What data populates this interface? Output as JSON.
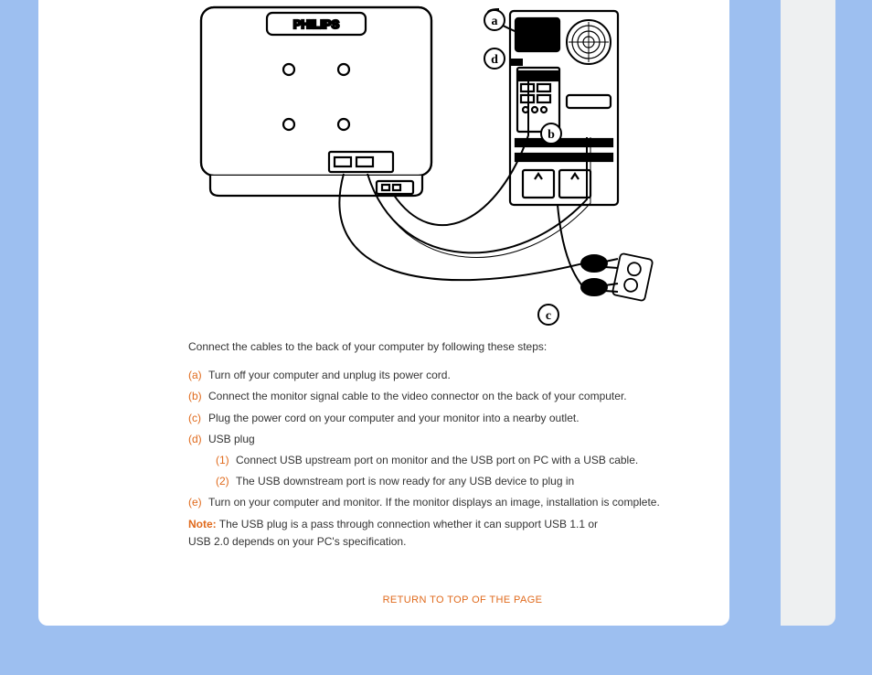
{
  "diagram": {
    "brand": "PHILIPS",
    "callouts": [
      "a",
      "d",
      "b",
      "c"
    ]
  },
  "intro": "Connect the cables to the back of your computer by following these steps:",
  "steps": [
    {
      "label": "(a)",
      "text": "Turn off your computer and unplug its power cord."
    },
    {
      "label": "(b)",
      "text": "Connect the monitor signal cable to the video connector on the back of your computer."
    },
    {
      "label": "(c)",
      "text": "Plug the power cord on your computer and your monitor into a nearby outlet."
    },
    {
      "label": "(d)",
      "text": "USB plug",
      "subs": [
        {
          "label": "(1)",
          "text": "Connect USB upstream port on monitor and the USB port on PC with a USB cable."
        },
        {
          "label": "(2)",
          "text": "The USB downstream port is now ready for any USB device to plug in"
        }
      ]
    },
    {
      "label": "(e)",
      "text": "Turn on your computer and monitor. If the monitor displays an image, installation is complete."
    }
  ],
  "note": {
    "label": "Note:",
    "text": "The USB plug is a pass through connection whether it can support USB 1.1 or USB 2.0 depends on your PC's specification."
  },
  "returnLink": "RETURN TO TOP OF THE PAGE"
}
